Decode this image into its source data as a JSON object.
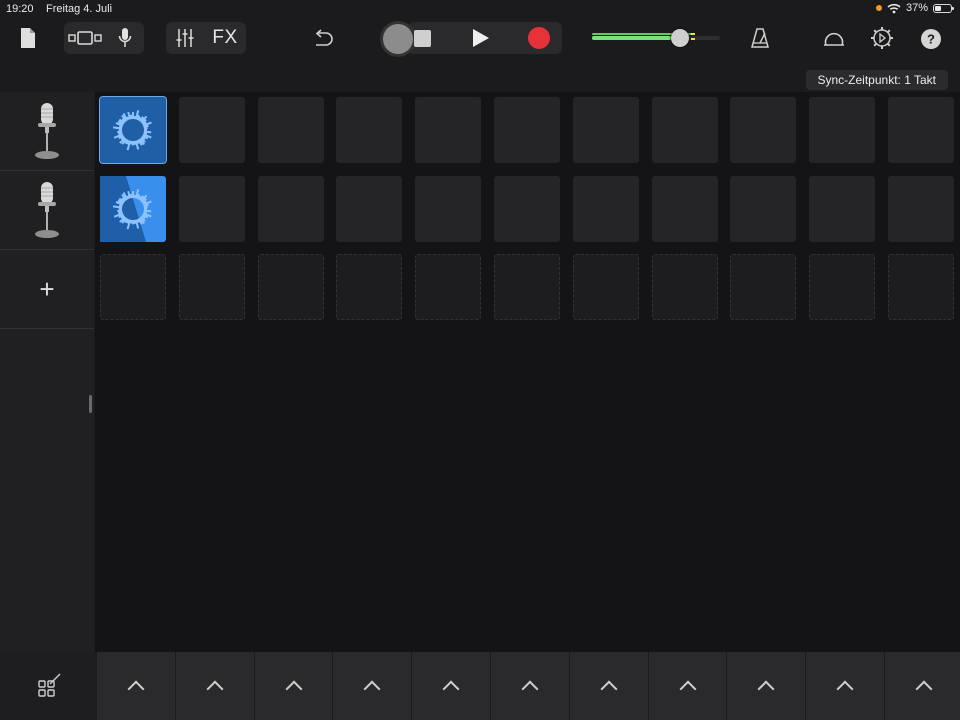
{
  "status_bar": {
    "time": "19:20",
    "date": "Freitag 4. Juli",
    "battery_percent": "37%",
    "battery_level": 0.37
  },
  "toolbar": {
    "fx_label": "FX",
    "volume_level": 0.62,
    "record_color": "#e8323a",
    "meter_color": "#7de07e"
  },
  "sync_badge": "Sync-Zeitpunkt: 1 Takt",
  "tracks": [
    {
      "instrument": "microphone-icon"
    },
    {
      "instrument": "microphone-icon"
    }
  ],
  "add_track_label": "+",
  "grid": {
    "columns": 11,
    "rows": 3,
    "cells": [
      {
        "row": 0,
        "col": 0,
        "state": "selected-loop"
      },
      {
        "row": 1,
        "col": 0,
        "state": "playing-loop"
      }
    ]
  },
  "bottom_chevrons": 11
}
